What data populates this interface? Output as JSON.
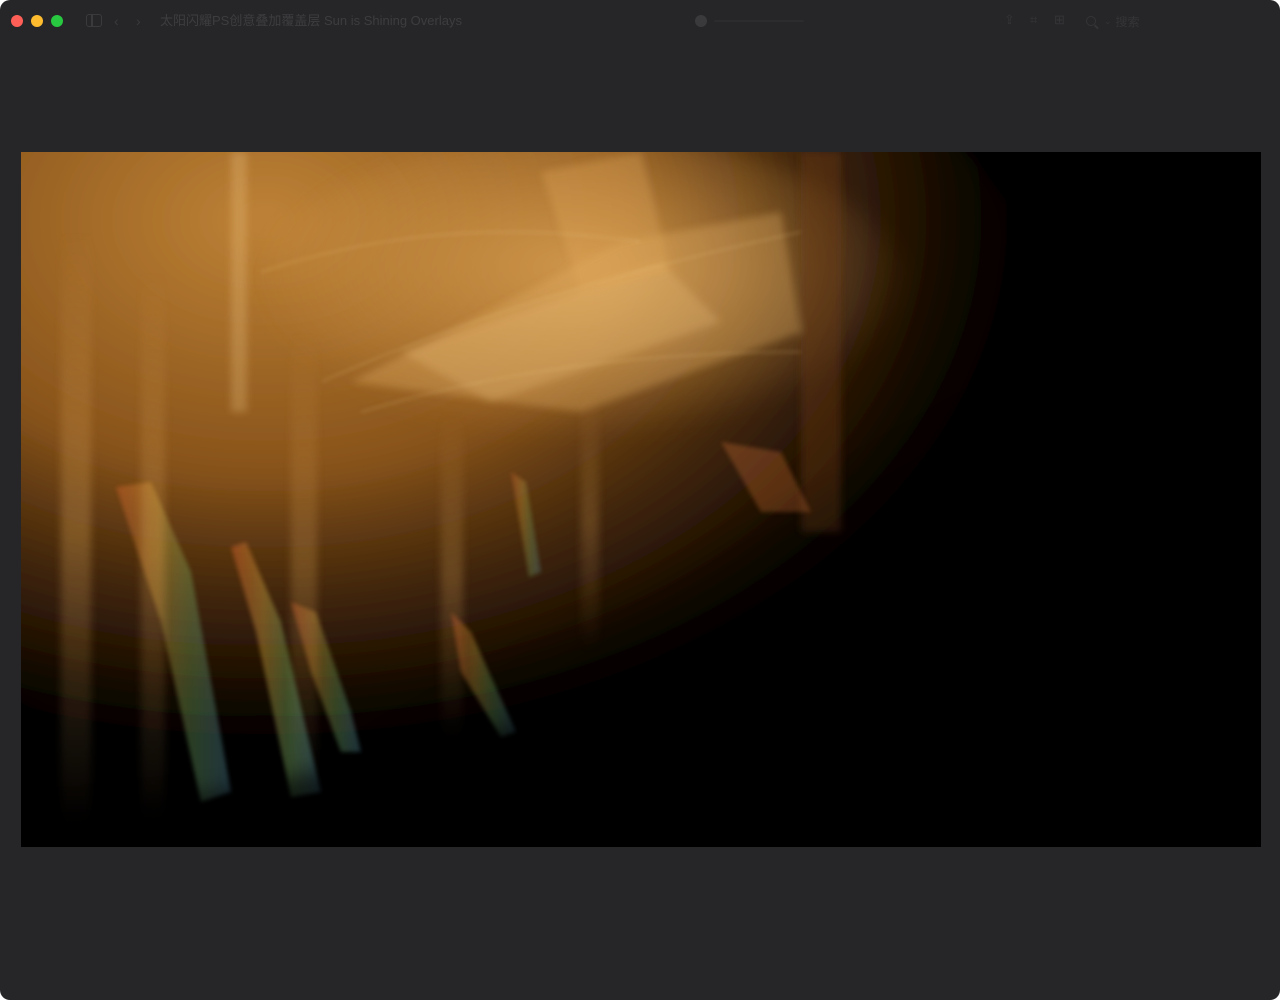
{
  "window": {
    "title": "太阳闪耀PS创意叠加覆盖层 Sun is Shining Overlays",
    "search_placeholder": "搜索"
  },
  "icons": {
    "close": "close-traffic-light",
    "minimize": "minimize-traffic-light",
    "zoom": "zoom-traffic-light",
    "sidebar": "sidebar-toggle-icon",
    "back": "chevron-left-icon",
    "forward": "chevron-right-icon",
    "share": "share-icon",
    "tag": "tag-icon",
    "grid": "grid-view-icon",
    "search": "search-icon"
  },
  "colors": {
    "window_bg": "#262628",
    "close": "#ff5f57",
    "minimize": "#febc2e",
    "zoom": "#28c840"
  }
}
